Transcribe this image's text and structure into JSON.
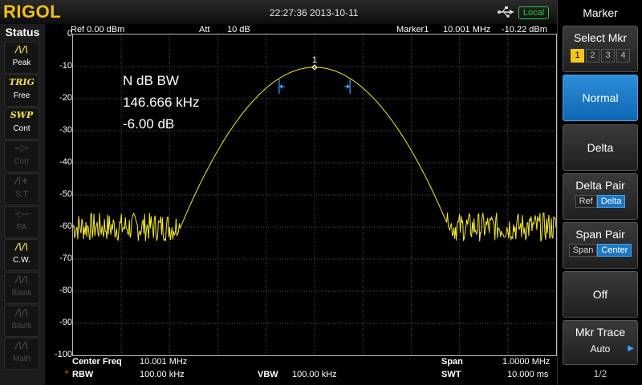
{
  "header": {
    "brand": "RIGOL",
    "datetime": "22:27:36 2013-10-11",
    "usb_icon": "usb-icon",
    "remote_state": "Local"
  },
  "status_panel": {
    "title": "Status",
    "items": [
      {
        "icon": "peak-icon",
        "glyph": "/\\/\\",
        "label": "Peak",
        "active": true
      },
      {
        "icon": "trig-icon",
        "glyph": "TRIG",
        "label": "Free",
        "active": true
      },
      {
        "icon": "swp-icon",
        "glyph": "SWP",
        "label": "Cont",
        "active": true
      },
      {
        "icon": "corr-icon",
        "glyph": "-◇-",
        "label": "Corr",
        "active": false
      },
      {
        "icon": "st-icon",
        "glyph": "/\\+",
        "label": "S.T",
        "active": false
      },
      {
        "icon": "pa-icon",
        "glyph": "-▷-",
        "label": "PA",
        "active": false
      },
      {
        "icon": "cw-icon",
        "glyph": "/\\/\\",
        "label": "C.W.",
        "active": true
      },
      {
        "icon": "blank-icon",
        "glyph": "/\\/\\",
        "label": "Blank",
        "active": false
      },
      {
        "icon": "blank-icon",
        "glyph": "/\\/\\",
        "label": "Blank",
        "active": false
      },
      {
        "icon": "math-icon",
        "glyph": "/\\/\\",
        "label": "Math",
        "active": false
      }
    ]
  },
  "display": {
    "ref": "Ref  0.00 dBm",
    "att": "Att",
    "att_value": "10 dB",
    "marker_label": "Marker1",
    "marker_freq": "10.001 MHz",
    "marker_level": "-10.22 dBm",
    "y_ticks": [
      "0",
      "-10",
      "-20",
      "-30",
      "-40",
      "-50",
      "-60",
      "-70",
      "-80",
      "-90",
      "-100"
    ],
    "annotation": {
      "mode": "N dB BW",
      "bandwidth": "146.666 kHz",
      "ndb": "-6.00 dB"
    },
    "marker_number": "1",
    "footer": {
      "center_freq_label": "Center Freq",
      "center_freq_value": "10.001 MHz",
      "span_label": "Span",
      "span_value": "1.0000 MHz",
      "rbw_star": "*",
      "rbw_label": "RBW",
      "rbw_value": "100.00 kHz",
      "vbw_label": "VBW",
      "vbw_value": "100.00 kHz",
      "swt_label": "SWT",
      "swt_value": "10.000 ms"
    },
    "trace_color": "#f4ea2a",
    "marker_color": "#3ba3ff"
  },
  "chart_data": {
    "type": "line",
    "xlim": [
      9.501,
      10.501
    ],
    "ylim": [
      -100,
      0
    ],
    "center_mhz": 10.001,
    "peak_dbm": -10.22,
    "noise_floor_dbm": -60,
    "ndb_bandwidth_khz": 146.666,
    "ndb_level_db": -6.0
  },
  "menu": {
    "title": "Marker",
    "select_mkr_label": "Select Mkr",
    "markers": [
      "1",
      "2",
      "3",
      "4"
    ],
    "selected_marker": "1",
    "normal_label": "Normal",
    "delta_label": "Delta",
    "delta_pair_label": "Delta Pair",
    "delta_pair_opts": [
      "Ref",
      "Delta"
    ],
    "span_pair_label": "Span Pair",
    "span_pair_opts": [
      "Span",
      "Center"
    ],
    "off_label": "Off",
    "mkr_trace_label": "Mkr Trace",
    "mkr_trace_value": "Auto",
    "page": "1/2"
  }
}
